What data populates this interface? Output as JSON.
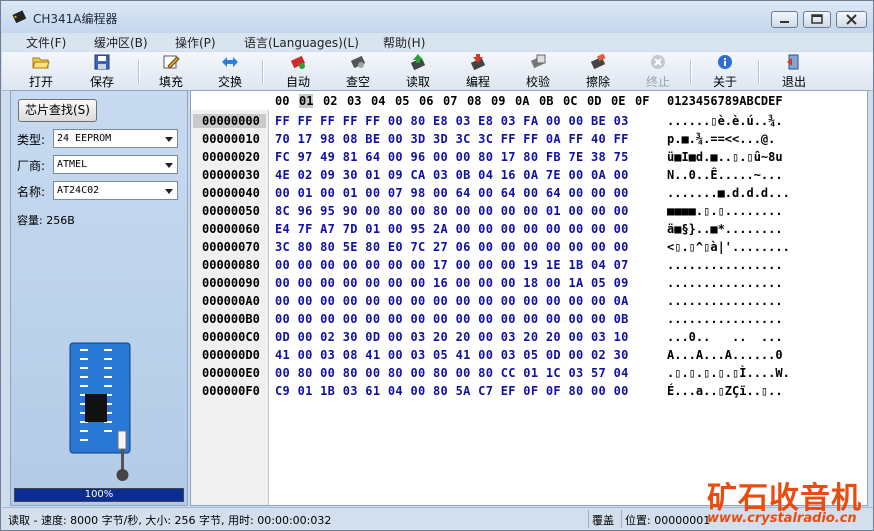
{
  "app": {
    "title": "CH341A编程器"
  },
  "menu": [
    "文件(F)",
    "缓冲区(B)",
    "操作(P)",
    "语言(Languages)(L)",
    "帮助(H)"
  ],
  "toolbar": {
    "open": "打开",
    "save": "保存",
    "fill": "填充",
    "swap": "交换",
    "auto": "自动",
    "blank": "查空",
    "read": "读取",
    "program": "编程",
    "verify": "校验",
    "erase": "擦除",
    "stop": "终止",
    "about": "关于",
    "exit": "退出"
  },
  "panel": {
    "detect_button": "芯片查找(S)",
    "type_label": "类型:",
    "type_value": "24 EEPROM",
    "vendor_label": "厂商:",
    "vendor_value": "ATMEL",
    "name_label": "名称:",
    "name_value": "AT24C02",
    "capacity": "容量: 256B",
    "progress_text": "100%",
    "progress_fraction": 1.0
  },
  "hex": {
    "columns": [
      "00",
      "01",
      "02",
      "03",
      "04",
      "05",
      "06",
      "07",
      "08",
      "09",
      "0A",
      "0B",
      "0C",
      "0D",
      "0E",
      "0F"
    ],
    "ascii_header": "0123456789ABCDEF",
    "rows": [
      {
        "addr": "00000000",
        "hex": "FF FF FF FF FF 00 80 E8 03 E8 03 FA 00 00 BE 03",
        "ascii": "......▯è.è.ú..¾."
      },
      {
        "addr": "00000010",
        "hex": "70 17 98 08 BE 00 3D 3D 3C 3C FF FF 0A FF 40 FF",
        "ascii": "p.■.¾.==<<...@."
      },
      {
        "addr": "00000020",
        "hex": "FC 97 49 81 64 00 96 00 00 80 17 80 FB 7E 38 75",
        "ascii": "ü■I■d.■..▯.▯û~8u"
      },
      {
        "addr": "00000030",
        "hex": "4E 02 09 30 01 09 CA 03 0B 04 16 0A 7E 00 0A 00",
        "ascii": "N..0..Ê.....~..."
      },
      {
        "addr": "00000040",
        "hex": "00 01 00 01 00 07 98 00 64 00 64 00 64 00 00 00",
        "ascii": ".......■.d.d.d..."
      },
      {
        "addr": "00000050",
        "hex": "8C 96 95 90 00 80 00 80 00 00 00 00 01 00 00 00",
        "ascii": "■■■■.▯.▯........"
      },
      {
        "addr": "00000060",
        "hex": "E4 7F A7 7D 01 00 95 2A 00 00 00 00 00 00 00 00",
        "ascii": "ä■§}..■*........"
      },
      {
        "addr": "00000070",
        "hex": "3C 80 80 5E 80 E0 7C 27 06 00 00 00 00 00 00 00",
        "ascii": "<▯.▯^▯à|'........"
      },
      {
        "addr": "00000080",
        "hex": "00 00 00 00 00 00 00 17 00 00 00 19 1E 1B 04 07",
        "ascii": "................"
      },
      {
        "addr": "00000090",
        "hex": "00 00 00 00 00 00 00 16 00 00 00 18 00 1A 05 09",
        "ascii": "................"
      },
      {
        "addr": "000000A0",
        "hex": "00 00 00 00 00 00 00 00 00 00 00 00 00 00 00 0A",
        "ascii": "................"
      },
      {
        "addr": "000000B0",
        "hex": "00 00 00 00 00 00 00 00 00 00 00 00 00 00 00 0B",
        "ascii": "................"
      },
      {
        "addr": "000000C0",
        "hex": "0D 00 02 30 0D 00 03 20 20 00 03 20 20 00 03 10",
        "ascii": "...0..   ..  ..."
      },
      {
        "addr": "000000D0",
        "hex": "41 00 03 08 41 00 03 05 41 00 03 05 0D 00 02 30",
        "ascii": "A...A...A......0"
      },
      {
        "addr": "000000E0",
        "hex": "00 80 00 80 00 80 00 80 00 80 CC 01 1C 03 57 04",
        "ascii": ".▯.▯.▯.▯.▯Ì....W."
      },
      {
        "addr": "000000F0",
        "hex": "C9 01 1B 03 61 04 00 80 5A C7 EF 0F 0F 80 00 00",
        "ascii": "É...a..▯ZÇï..▯.."
      }
    ]
  },
  "status": {
    "left": "读取 - 速度: 8000 字节/秒, 大小: 256 字节, 用时: 00:00:00:032",
    "mode": "覆盖",
    "position": "位置: 00000001"
  },
  "watermark": {
    "text": "矿石收音机",
    "url": "www.crystalradio.cn"
  },
  "colors": {
    "hex_text": "#1010a8",
    "progress": "#0a2e8f",
    "watermark": "#e84c10"
  }
}
